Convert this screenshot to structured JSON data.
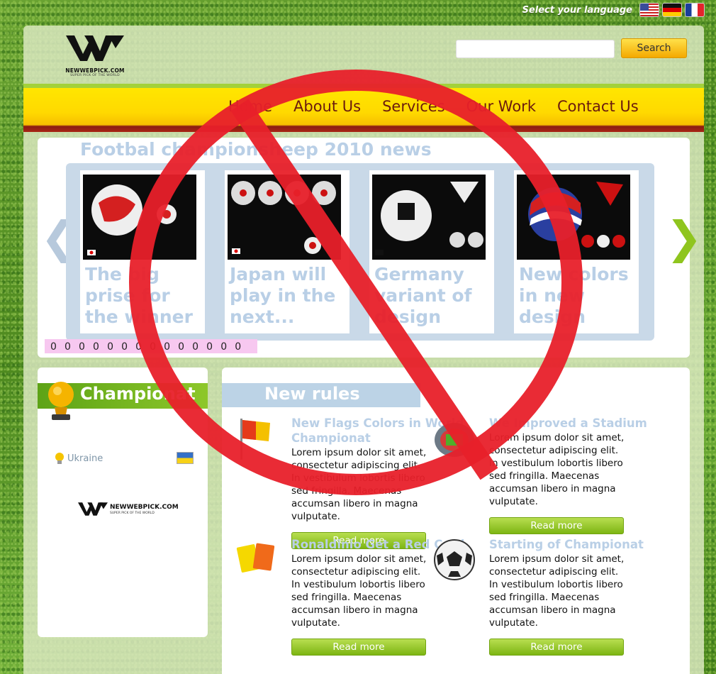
{
  "language": {
    "label": "Select your language",
    "flags": [
      "us-flag-icon",
      "de-flag-icon",
      "fr-flag-icon"
    ]
  },
  "header": {
    "logo_text": "NEWWEBPICK.COM",
    "logo_subtitle": "SUPER PICK OF THE WORLD",
    "search_placeholder": "",
    "search_button": "Search"
  },
  "nav": {
    "items": [
      {
        "label": "Home"
      },
      {
        "label": "About Us"
      },
      {
        "label": "Services"
      },
      {
        "label": "Our Work"
      },
      {
        "label": "Contact Us"
      }
    ]
  },
  "slider": {
    "title": "Footbal championsheep 2010 news",
    "slides": [
      {
        "caption": "The big prise for the winner"
      },
      {
        "caption": "Japan will play in the next..."
      },
      {
        "caption": "Germany variant of design"
      },
      {
        "caption": "New colors in new design"
      }
    ],
    "dots": [
      "0",
      "0",
      "0",
      "0",
      "0",
      "0",
      "0",
      "0",
      "0",
      "0",
      "0",
      "0",
      "0",
      "0"
    ],
    "prev_icon": "chevron-left-icon",
    "next_icon": "chevron-right-icon"
  },
  "sidebar": {
    "title": "Championat",
    "country": "Ukraine",
    "logo_text": "NEWWEBPICK.COM",
    "logo_subtitle": "SUPER PICK OF THE WORLD"
  },
  "main": {
    "title": "New rules",
    "articles": [
      {
        "title": "New Flags Colors in World Championat",
        "body": "Lorem ipsum dolor sit amet, consectetur adipiscing elit. In vestibulum lobortis libero sed fringilla. Maecenas accumsan libero in magna vulputate.",
        "button": "Read more",
        "icon": "corner-flag-icon"
      },
      {
        "title": "We Improved a Stadium",
        "body": "Lorem ipsum dolor sit amet, consectetur adipiscing elit. In vestibulum lobortis libero sed fringilla. Maecenas accumsan libero in magna vulputate.",
        "button": "Read more",
        "icon": "stadium-icon"
      },
      {
        "title": "Ronaldinio Get a Red Card",
        "body": "Lorem ipsum dolor sit amet, consectetur adipiscing elit. In vestibulum lobortis libero sed fringilla. Maecenas accumsan libero in magna vulputate.",
        "button": "Read more",
        "icon": "penalty-cards-icon"
      },
      {
        "title": "Starting of Championat",
        "body": "Lorem ipsum dolor sit amet, consectetur adipiscing elit. In vestibulum lobortis libero sed fringilla. Maecenas accumsan libero in magna vulputate.",
        "button": "Read more",
        "icon": "soccer-ball-icon"
      }
    ]
  },
  "colors": {
    "nav_text": "#6a1a0e",
    "accent_green": "#8dc72a",
    "title_blue": "#b9cfe6",
    "prohibition_red": "#e8202a"
  }
}
